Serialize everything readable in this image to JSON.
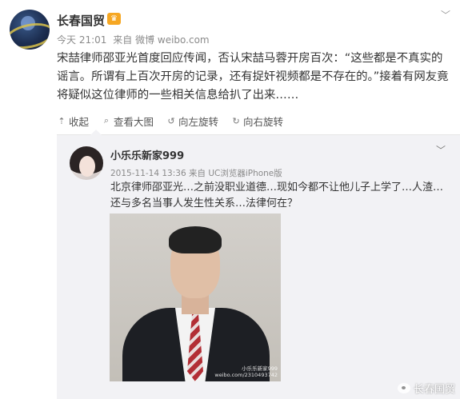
{
  "post": {
    "author": "长春国贸",
    "badge_icon": "vip-crown-icon",
    "menu_icon": "chevron-down-icon",
    "time": "今天 21:01",
    "source_prefix": "来自",
    "source": "微博 weibo.com",
    "text": "宋喆律师邵亚光首度回应传闻，否认宋喆马蓉开房百次：“这些都是不真实的谣言。所谓有上百次开房的记录，还有捉奸视频都是不存在的。”接着有网友竟将疑似这位律师的一些相关信息给扒了出来……"
  },
  "actions": [
    {
      "label": "收起",
      "icon": "collapse-up-icon",
      "glyph": "⇡"
    },
    {
      "label": "查看大图",
      "icon": "zoom-in-icon",
      "glyph": "⌕"
    },
    {
      "label": "向左旋转",
      "icon": "rotate-left-icon",
      "glyph": "↺"
    },
    {
      "label": "向右旋转",
      "icon": "rotate-right-icon",
      "glyph": "↻"
    }
  ],
  "repost": {
    "author": "小乐乐新家999",
    "time": "2015-11-14 13:36",
    "source_prefix": "来自",
    "source": "UC浏览器iPhone版",
    "text": "北京律师邵亚光…之前没职业道德…现如今都不让他儿子上学了…人渣…还与多名当事人发生性关系…法律何在？",
    "photo_watermark": "小乐乐新家999\nweibo.com/2310493742"
  },
  "watermark": {
    "text": "长春国贸"
  },
  "colors": {
    "text": "#333333",
    "meta": "#8a8a8a",
    "repost_bg": "#f2f2f5",
    "badge": "#f6a723"
  }
}
